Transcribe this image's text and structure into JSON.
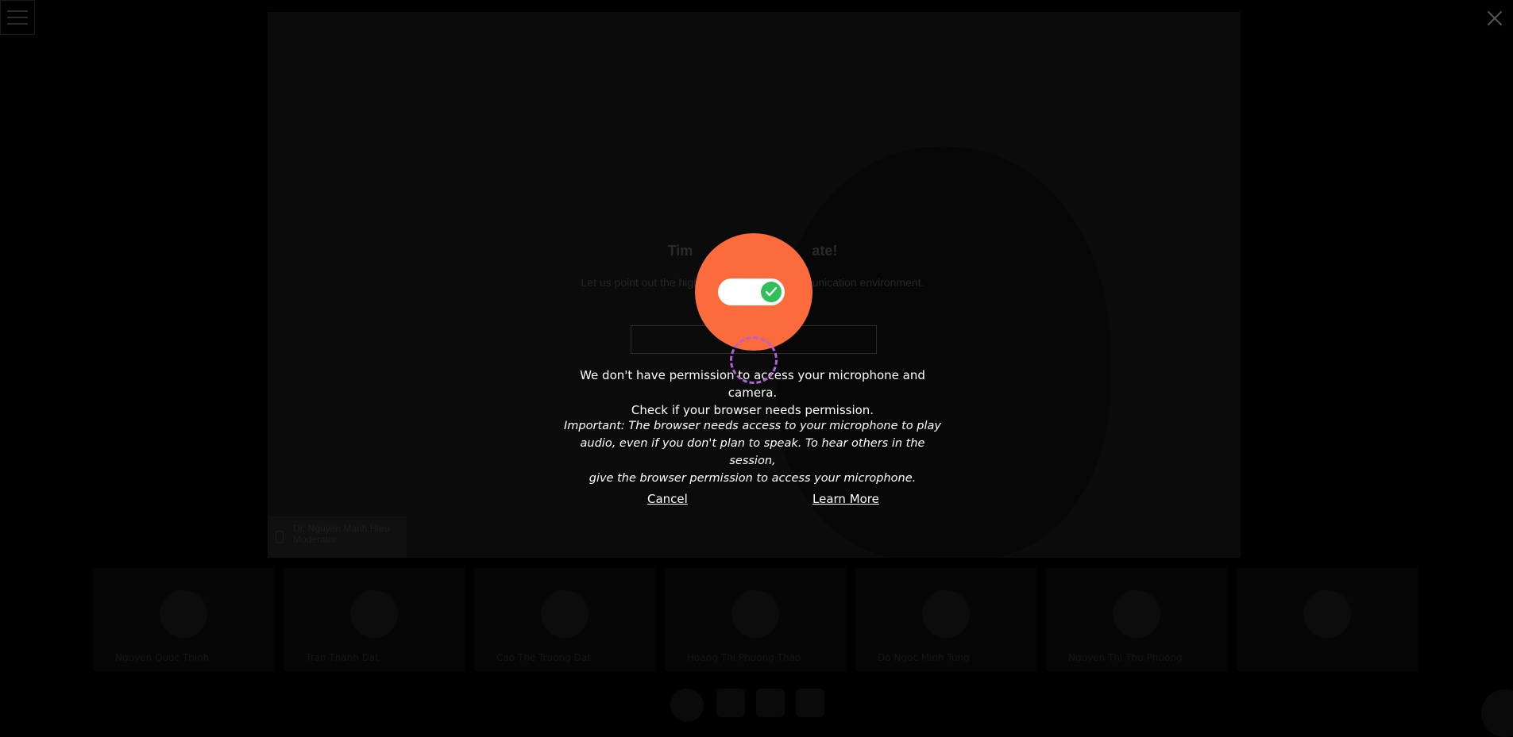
{
  "background_title": "Time to ... ate!",
  "dialog": {
    "title_left": "Tim",
    "title_right": "ate!",
    "subtitle_left": "Let us point out the high",
    "subtitle_right": "munication environment.",
    "message_line1": "We don't have permission to access your microphone and camera.",
    "message_line2": "Check if your browser needs permission.",
    "important_line1": "Important: The browser needs access to your microphone to play",
    "important_line2": "audio, even if you don't plan to speak. To hear others in the session,",
    "important_line3": "give the browser permission to access your microphone.",
    "cancel_label": "Cancel",
    "learn_more_label": "Learn More"
  },
  "main_video": {
    "label_line1": "Dr. Nguyen Manh Hieu",
    "label_line2": "Moderator"
  },
  "participants": [
    {
      "name": "Nguyen Quoc Thinh"
    },
    {
      "name": "Tran Thanh Dat"
    },
    {
      "name": "Cao The Truong Dat"
    },
    {
      "name": "Hoang Thi Phuong Thao"
    },
    {
      "name": "Do Ngoc Minh Tung"
    },
    {
      "name": "Nguyen Thi Thu Phuong"
    },
    {
      "name": ""
    }
  ],
  "colors": {
    "accent_orange": "#fb6b3b",
    "toggle_green": "#2fbf5b",
    "focus_ring": "#b261d6"
  },
  "icons": [
    "menu-icon",
    "close-icon",
    "toggle-icon",
    "check-icon",
    "microphone-icon"
  ]
}
